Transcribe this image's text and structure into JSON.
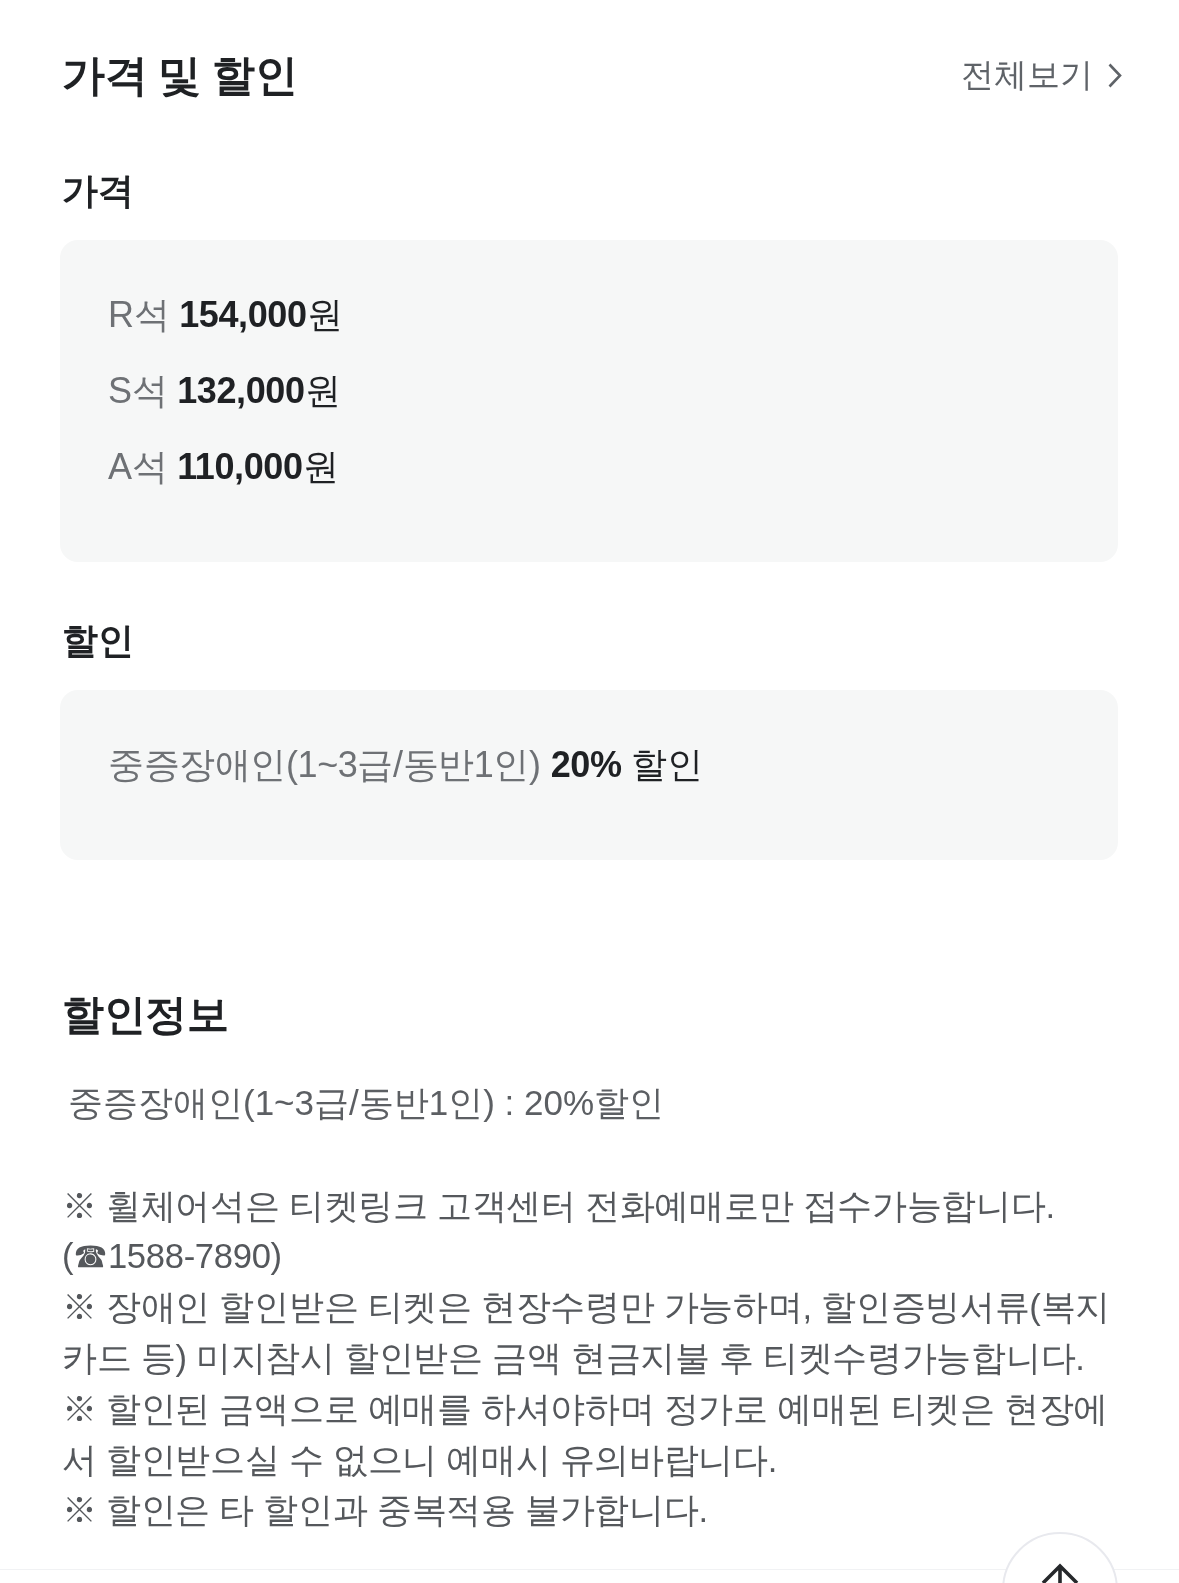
{
  "header": {
    "title": "가격 및 할인",
    "view_all": "전체보기"
  },
  "price": {
    "heading": "가격",
    "rows": [
      {
        "label": "R석",
        "value": "**154,000**원"
      },
      {
        "label": "S석",
        "value": "**132,000**원"
      },
      {
        "label": "A석",
        "value": "**110,000**원"
      }
    ]
  },
  "discount": {
    "heading": "할인",
    "rows": [
      {
        "label": "중증장애인(1~3급/동반1인)",
        "value": "**20%** 할인"
      }
    ]
  },
  "discount_info": {
    "heading": "할인정보",
    "summary": "중증장애인(1~3급/동반1인) : 20%할인",
    "notices": [
      "※ 휠체어석은 티켓링크 고객센터 전화예매로만 접수가능합니다. (☎1588-7890)",
      "※ 장애인 할인받은 티켓은 현장수령만 가능하며, 할인증빙서류(복지카드 등) 미지참시 할인받은 금액 현금지불 후 티켓수령가능합니다.",
      "※ 할인된 금액으로 예매를 하셔야하며 정가로 예매된 티켓은 현장에서 할인받으실 수 없으니 예매시 유의바랍니다.",
      "※ 할인은 타 할인과 중복적용 불가합니다."
    ]
  }
}
